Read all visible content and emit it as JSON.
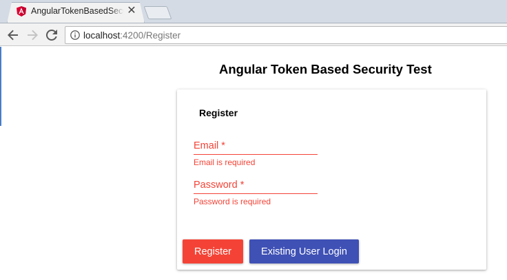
{
  "browser": {
    "tab": {
      "title": "AngularTokenBasedSecurity",
      "favicon": "angular-icon",
      "close_glyph": "✕"
    },
    "address_bar": {
      "host": "localhost",
      "path": ":4200/Register"
    },
    "nav": {
      "back": "back-arrow-icon",
      "forward": "forward-arrow-icon",
      "reload": "reload-icon",
      "info": "info-icon"
    }
  },
  "page": {
    "title": "Angular Token Based Security Test",
    "form": {
      "title": "Register",
      "email": {
        "label": "Email *",
        "error": "Email is required"
      },
      "password": {
        "label": "Password *",
        "error": "Password is required"
      },
      "buttons": {
        "register": "Register",
        "login": "Existing User Login"
      }
    }
  },
  "colors": {
    "error": "#f44336",
    "primary": "#3f51b5",
    "warn": "#f44336",
    "chrome_tabstrip": "#d4dbe4",
    "chrome_toolbar": "#f2f2f2"
  }
}
